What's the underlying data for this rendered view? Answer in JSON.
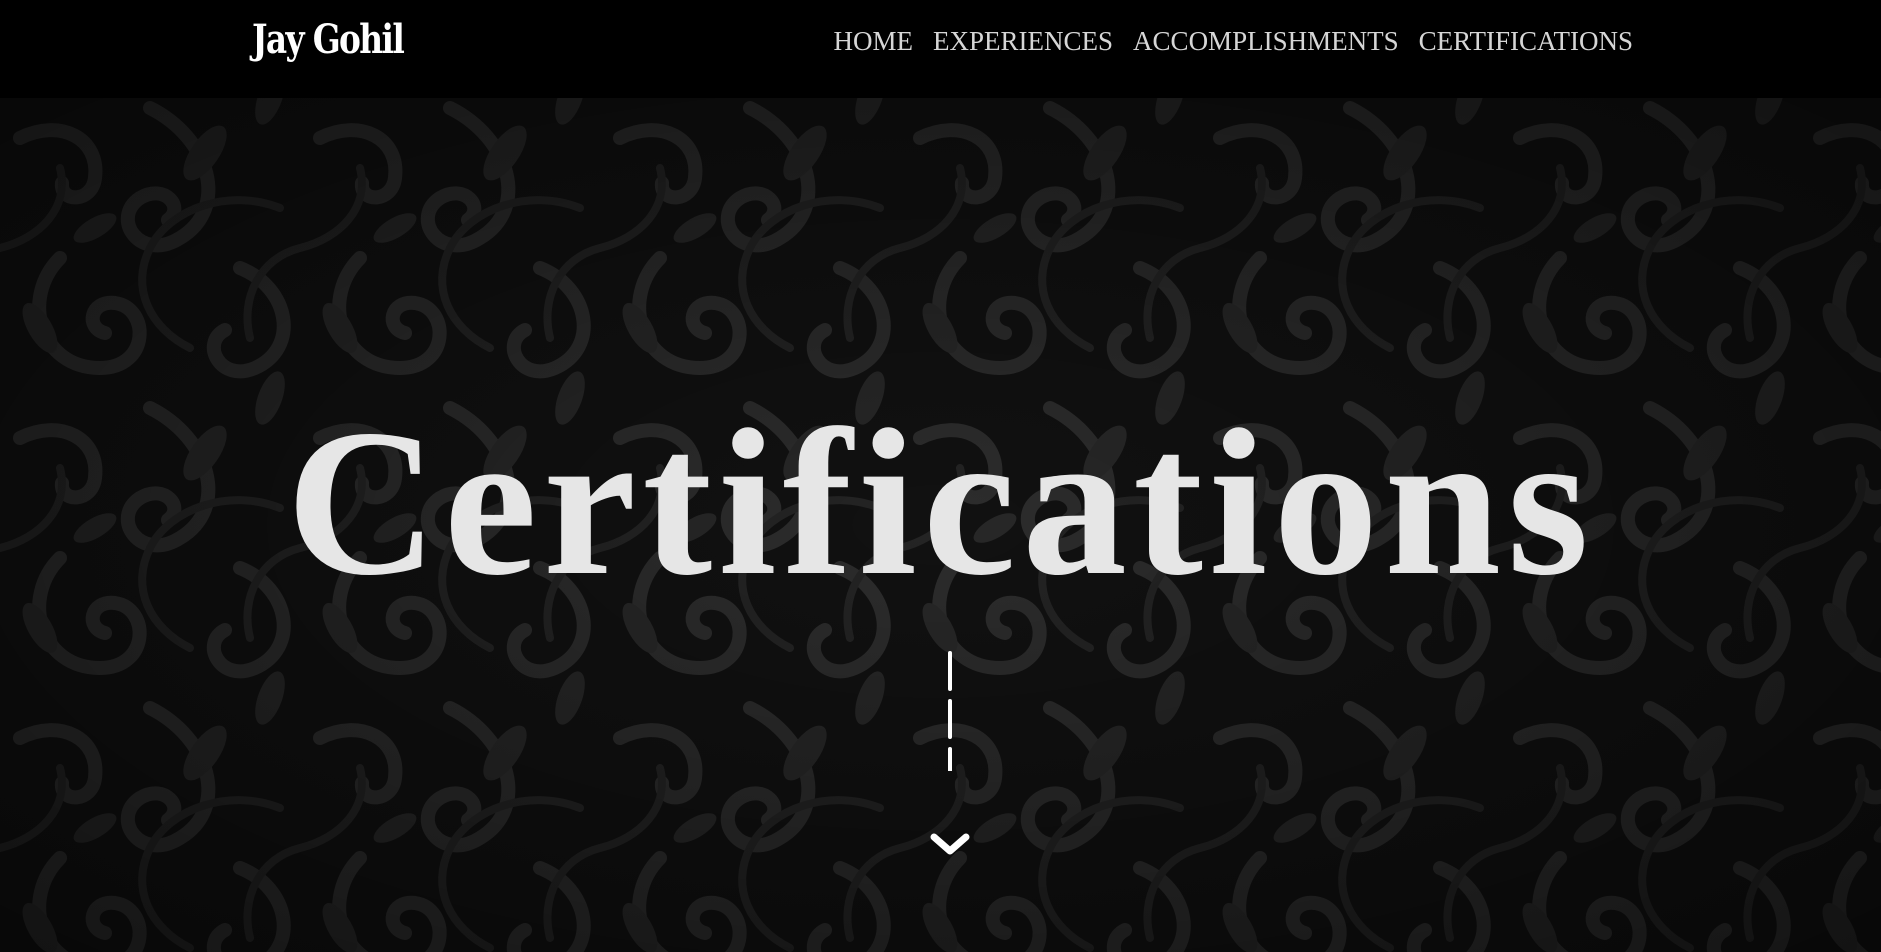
{
  "header": {
    "brand": "Jay Gohil",
    "nav": [
      "HOME",
      "EXPERIENCES",
      "ACCOMPLISHMENTS",
      "CERTIFICATIONS"
    ]
  },
  "hero": {
    "title": "Certifications",
    "scroll_icon": "chevron-down-icon"
  },
  "colors": {
    "nav_background": "#000000",
    "title": "#e6e6e6",
    "nav_text": "#d6d6d6",
    "pattern_dark": "#0c0c0c",
    "pattern_light": "#3a3a3a"
  }
}
